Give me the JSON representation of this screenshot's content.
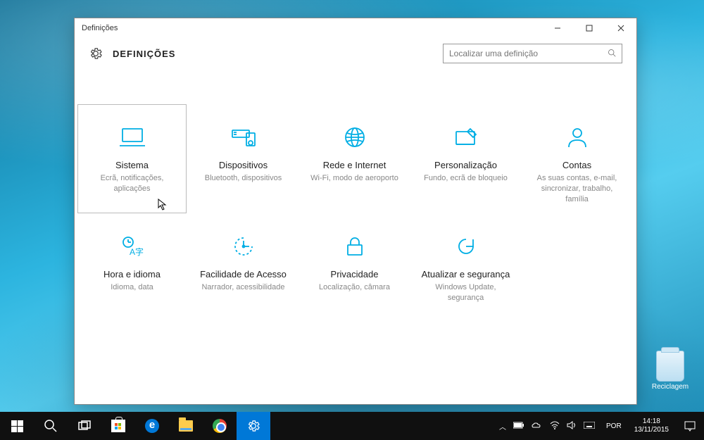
{
  "window": {
    "title": "Definições",
    "header": "DEFINIÇÕES",
    "search_placeholder": "Localizar uma definição"
  },
  "tiles": [
    {
      "title": "Sistema",
      "desc": "Ecrã, notificações, aplicações",
      "selected": true
    },
    {
      "title": "Dispositivos",
      "desc": "Bluetooth, dispositivos"
    },
    {
      "title": "Rede e Internet",
      "desc": "Wi-Fi, modo de aeroporto"
    },
    {
      "title": "Personalização",
      "desc": "Fundo, ecrã de bloqueio"
    },
    {
      "title": "Contas",
      "desc": "As suas contas, e-mail, sincronizar, trabalho, família"
    },
    {
      "title": "Hora e idioma",
      "desc": "Idioma, data"
    },
    {
      "title": "Facilidade de Acesso",
      "desc": "Narrador, acessibilidade"
    },
    {
      "title": "Privacidade",
      "desc": "Localização, câmara"
    },
    {
      "title": "Atualizar e segurança",
      "desc": "Windows Update, segurança"
    }
  ],
  "desktop": {
    "recycle_label": "Reciclagem"
  },
  "taskbar": {
    "language": "POR",
    "time": "14:18",
    "date": "13/11/2015"
  }
}
